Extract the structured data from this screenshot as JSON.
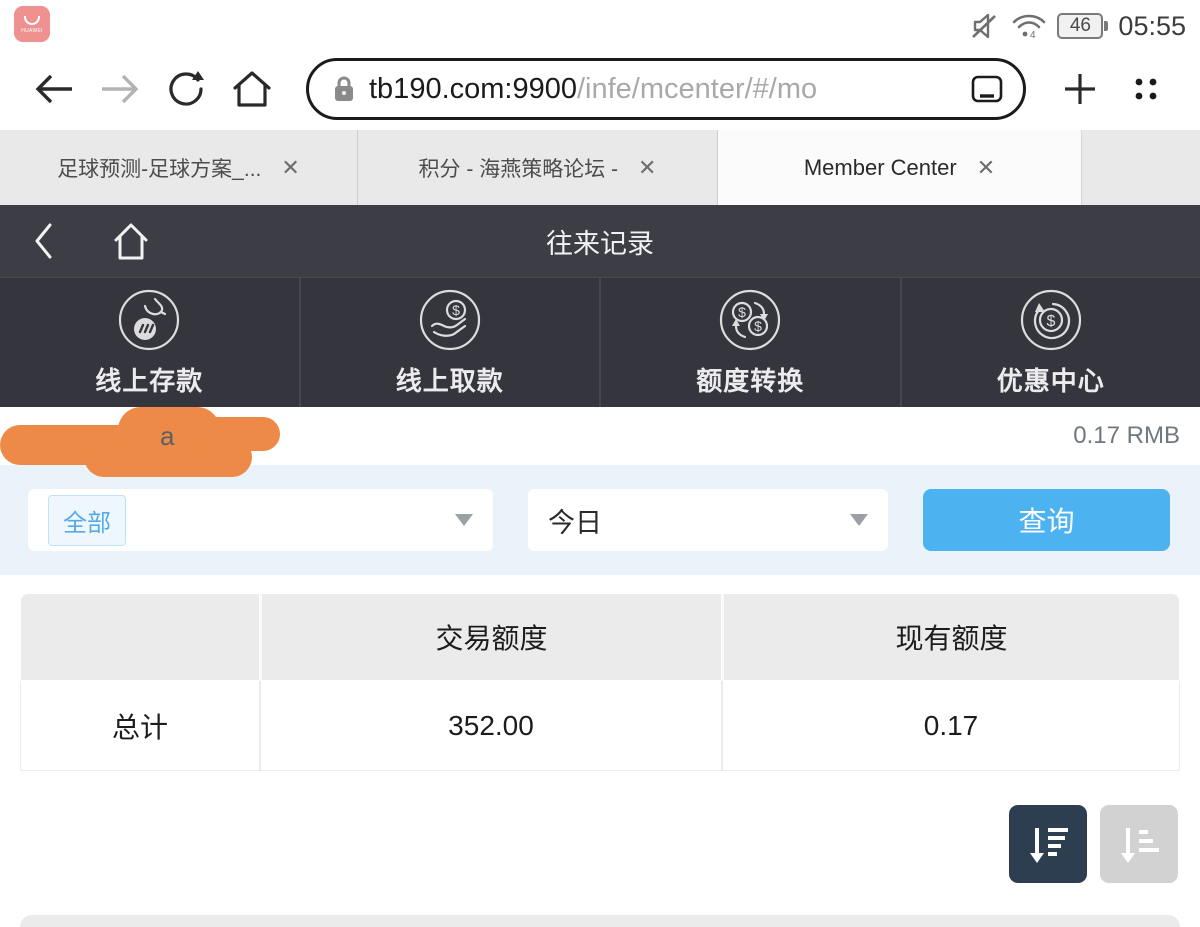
{
  "status_bar": {
    "time": "05:55",
    "battery": "46"
  },
  "browser": {
    "url": {
      "host": "tb190.com:9900",
      "path": "/infe/mcenter/#/mo"
    },
    "tabs": [
      {
        "label": "足球预测-足球方案_...",
        "close": "✕"
      },
      {
        "label": "积分 - 海燕策略论坛 -",
        "close": "✕"
      },
      {
        "label": "Member Center",
        "close": "✕"
      }
    ]
  },
  "header": {
    "title": "往来记录"
  },
  "menu": {
    "items": [
      {
        "label": "线上存款",
        "icon": "deposit-icon"
      },
      {
        "label": "线上取款",
        "icon": "withdraw-icon"
      },
      {
        "label": "额度转换",
        "icon": "exchange-icon"
      },
      {
        "label": "优惠中心",
        "icon": "promo-icon"
      }
    ]
  },
  "account": {
    "masked_char": "a",
    "balance": "0.17 RMB"
  },
  "filters": {
    "type_value": "全部",
    "date_value": "今日",
    "query_label": "查询"
  },
  "table": {
    "headers": {
      "col1": "",
      "col2": "交易额度",
      "col3": "现有额度"
    },
    "total_row": {
      "label": "总计",
      "transaction": "352.00",
      "current": "0.17"
    }
  },
  "colors": {
    "accent_blue": "#4db2f0",
    "dark_header": "#3d3d46",
    "menu_dark": "#35353e",
    "scribble_orange": "#ee8a47",
    "sort_active": "#2d3e50",
    "filter_bg": "#ebf3fa"
  }
}
